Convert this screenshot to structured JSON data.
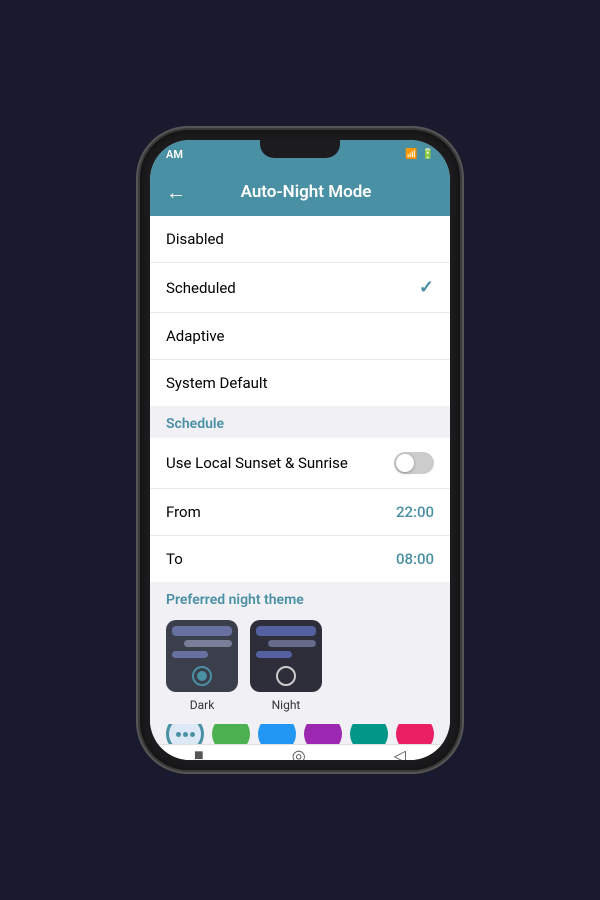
{
  "statusBar": {
    "time": "AM",
    "battery": "|||"
  },
  "header": {
    "backLabel": "←",
    "title": "Auto-Night Mode"
  },
  "modes": [
    {
      "id": "disabled",
      "label": "Disabled",
      "selected": false
    },
    {
      "id": "scheduled",
      "label": "Scheduled",
      "selected": true
    },
    {
      "id": "adaptive",
      "label": "Adaptive",
      "selected": false
    },
    {
      "id": "system-default",
      "label": "System Default",
      "selected": false
    }
  ],
  "scheduleSectionLabel": "Schedule",
  "schedule": {
    "sunsetToggleLabel": "Use Local Sunset & Sunrise",
    "sunsetToggleOn": false,
    "fromLabel": "From",
    "fromValue": "22:00",
    "toLabel": "To",
    "toValue": "08:00"
  },
  "preferredNightTheme": {
    "sectionLabel": "Preferred night theme",
    "themes": [
      {
        "id": "dark",
        "label": "Dark",
        "selected": true
      },
      {
        "id": "night",
        "label": "Night",
        "selected": false
      }
    ]
  },
  "colorPalette": {
    "swatches": [
      {
        "id": "multi",
        "color": "#e8f0f8",
        "active": true,
        "isMulti": true
      },
      {
        "id": "green",
        "color": "#4caf50",
        "active": false
      },
      {
        "id": "blue",
        "color": "#2196f3",
        "active": false
      },
      {
        "id": "purple",
        "color": "#9c27b0",
        "active": false
      },
      {
        "id": "teal",
        "color": "#009688",
        "active": false
      },
      {
        "id": "pink",
        "color": "#e91e63",
        "active": false
      }
    ]
  },
  "bottomNav": {
    "icons": [
      "■",
      "◎",
      "◁"
    ]
  }
}
